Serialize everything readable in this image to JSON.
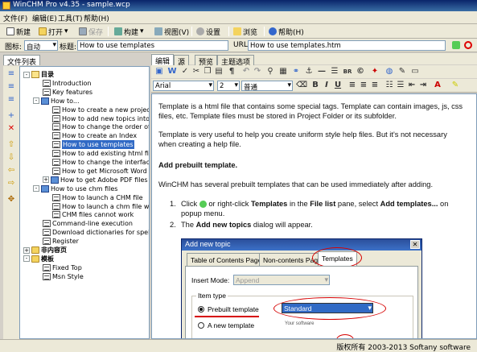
{
  "window": {
    "title": "WinCHM Pro v4.35 - sample.wcp"
  },
  "menu": [
    "文件(F)",
    "编辑(E)",
    "工具(T)",
    "帮助(H)"
  ],
  "toolbar": {
    "new": "新建",
    "open": "打开",
    "save": "保存",
    "build": "构建",
    "view": "视图(V)",
    "settings": "设置",
    "browse": "浏览",
    "help": "帮助(H)"
  },
  "props": {
    "icon_label": "图标:",
    "icon_value": "自动",
    "title_label": "标题:",
    "title_value": "How to use templates",
    "url_label": "URL:",
    "url_value": "How to use templates.htm"
  },
  "file_panel": {
    "tab": "文件列表"
  },
  "tree": [
    {
      "label": "目录",
      "bold": true
    },
    {
      "label": "Introduction"
    },
    {
      "label": "Key features"
    },
    {
      "label": "How to..."
    },
    {
      "label": "How to create a new project"
    },
    {
      "label": "How to add new topics into Tab"
    },
    {
      "label": "How to change the order of top"
    },
    {
      "label": "How to create an Index"
    },
    {
      "label": "How to use templates",
      "selected": true
    },
    {
      "label": "How to add existing html files to"
    },
    {
      "label": "How to change the interface of"
    },
    {
      "label": "How to get Microsoft Word Doc"
    },
    {
      "label": "How to get Adobe PDF files"
    },
    {
      "label": "How to use chm files"
    },
    {
      "label": "How to launch a CHM file"
    },
    {
      "label": "How to launch a chm file with a"
    },
    {
      "label": "CHM files cannot work"
    },
    {
      "label": "Command-line execution"
    },
    {
      "label": "Download dictionaries for spell chec"
    },
    {
      "label": "Register"
    },
    {
      "label": "非内容页",
      "bold": true
    },
    {
      "label": "模板",
      "bold": true
    },
    {
      "label": "Fixed Top"
    },
    {
      "label": "Msn Style"
    }
  ],
  "editor_tabs": [
    "编辑",
    "源",
    "预览",
    "主题选项"
  ],
  "format": {
    "font": "Arial",
    "size": "2",
    "style": "普通"
  },
  "doc": {
    "p1": "Template is a html file that contains some special tags. Template can contain images, js, css files, etc. Template files must be stored in Project Folder or its subfolder.",
    "p2": "Template is very useful to help you create uniform style help files. But it's not necessary when creating a help file.",
    "h1": "Add prebuilt template.",
    "p3": "WinCHM has several prebuilt templates that can be used immediately after adding.",
    "step1_num": "1.",
    "step1_a": "Click",
    "step1_b": "or right-click",
    "step1_templates": "Templates",
    "step1_c": "in the",
    "step1_filelist": "File list",
    "step1_d": "pane, select",
    "step1_addtemplates": "Add templates...",
    "step1_e": "on popup menu.",
    "step2_num": "2.",
    "step2_a": "The",
    "step2_dialog": "Add new topics",
    "step2_b": "dialog will appear."
  },
  "dialog": {
    "title": "Add new topic",
    "tab1": "Table of Contents Page",
    "tab2": "Non-contents Page",
    "tab3": "Templates",
    "insert_label": "Insert Mode:",
    "insert_value": "Append",
    "item_type": "Item type",
    "opt1": "Prebuilt template",
    "opt2": "A new template",
    "template_value": "Standard",
    "preview": "Your software"
  },
  "status": {
    "copyright": "版权所有 2003-2013 Softany software"
  },
  "colors": {
    "title_bar": "#0a246a",
    "selection": "#316ac5",
    "annotation": "#d60000"
  }
}
